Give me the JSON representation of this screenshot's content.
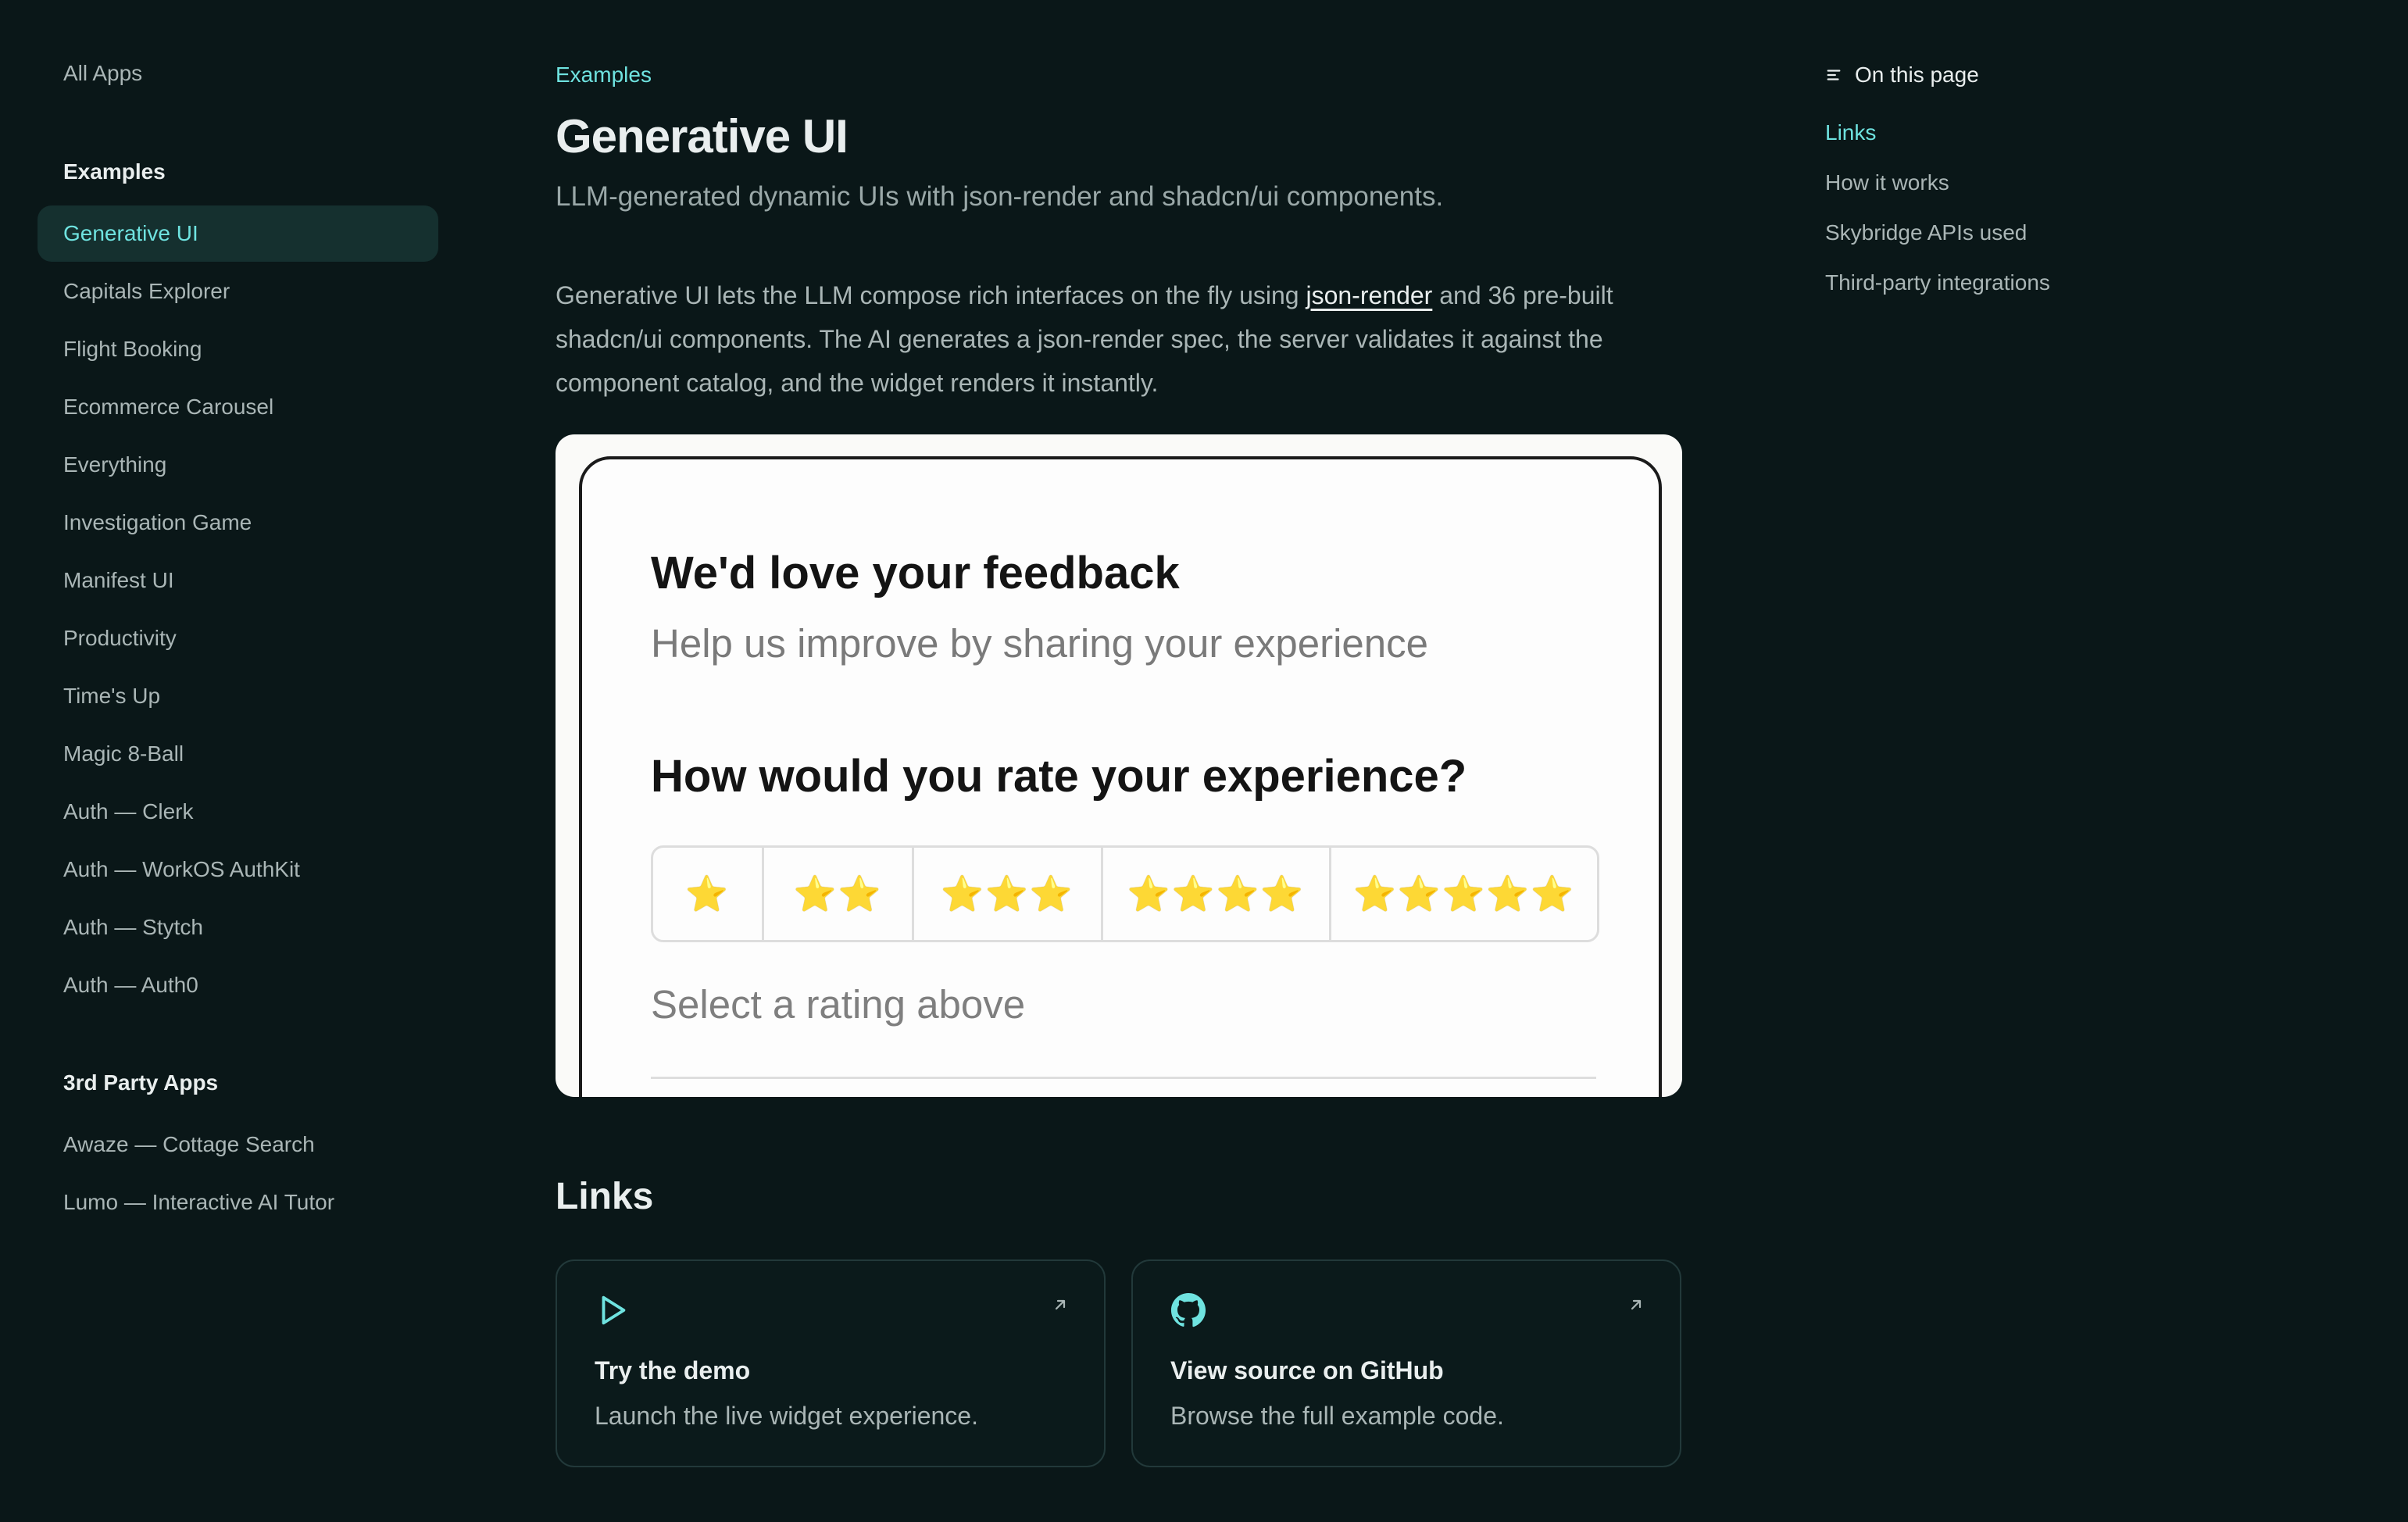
{
  "sidebar": {
    "all_apps": "All Apps",
    "examples_title": "Examples",
    "items": [
      {
        "label": "Generative UI",
        "active": true
      },
      {
        "label": "Capitals Explorer"
      },
      {
        "label": "Flight Booking"
      },
      {
        "label": "Ecommerce Carousel"
      },
      {
        "label": "Everything"
      },
      {
        "label": "Investigation Game"
      },
      {
        "label": "Manifest UI"
      },
      {
        "label": "Productivity"
      },
      {
        "label": "Time's Up"
      },
      {
        "label": "Magic 8-Ball"
      },
      {
        "label": "Auth — Clerk"
      },
      {
        "label": "Auth — WorkOS AuthKit"
      },
      {
        "label": "Auth — Stytch"
      },
      {
        "label": "Auth — Auth0"
      }
    ],
    "third_party_title": "3rd Party Apps",
    "third_party_items": [
      {
        "label": "Awaze — Cottage Search"
      },
      {
        "label": "Lumo — Interactive AI Tutor"
      }
    ]
  },
  "main": {
    "breadcrumb": "Examples",
    "title": "Generative UI",
    "subtitle": "LLM-generated dynamic UIs with json-render and shadcn/ui components.",
    "intro_before": "Generative UI lets the LLM compose rich interfaces on the fly using ",
    "intro_link": "json-render",
    "intro_after": " and 36 pre-built shadcn/ui components. The AI generates a json-render spec, the server validates it against the component catalog, and the widget renders it instantly.",
    "preview": {
      "title": "We'd love your feedback",
      "subtitle": "Help us improve by sharing your experience",
      "question": "How would you rate your experience?",
      "ratings": [
        "⭐",
        "⭐⭐",
        "⭐⭐⭐",
        "⭐⭐⭐⭐",
        "⭐⭐⭐⭐⭐"
      ],
      "note": "Select a rating above"
    },
    "links_heading": "Links",
    "links": [
      {
        "title": "Try the demo",
        "desc": "Launch the live widget experience.",
        "icon": "play-icon"
      },
      {
        "title": "View source on GitHub",
        "desc": "Browse the full example code.",
        "icon": "github-icon"
      }
    ]
  },
  "toc": {
    "heading": "On this page",
    "items": [
      {
        "label": "Links",
        "active": true
      },
      {
        "label": "How it works"
      },
      {
        "label": "Skybridge APIs used"
      },
      {
        "label": "Third-party integrations"
      }
    ]
  },
  "colors": {
    "background": "#0a1718",
    "accent": "#6fe3e0",
    "active_nav_bg": "#15302f"
  }
}
